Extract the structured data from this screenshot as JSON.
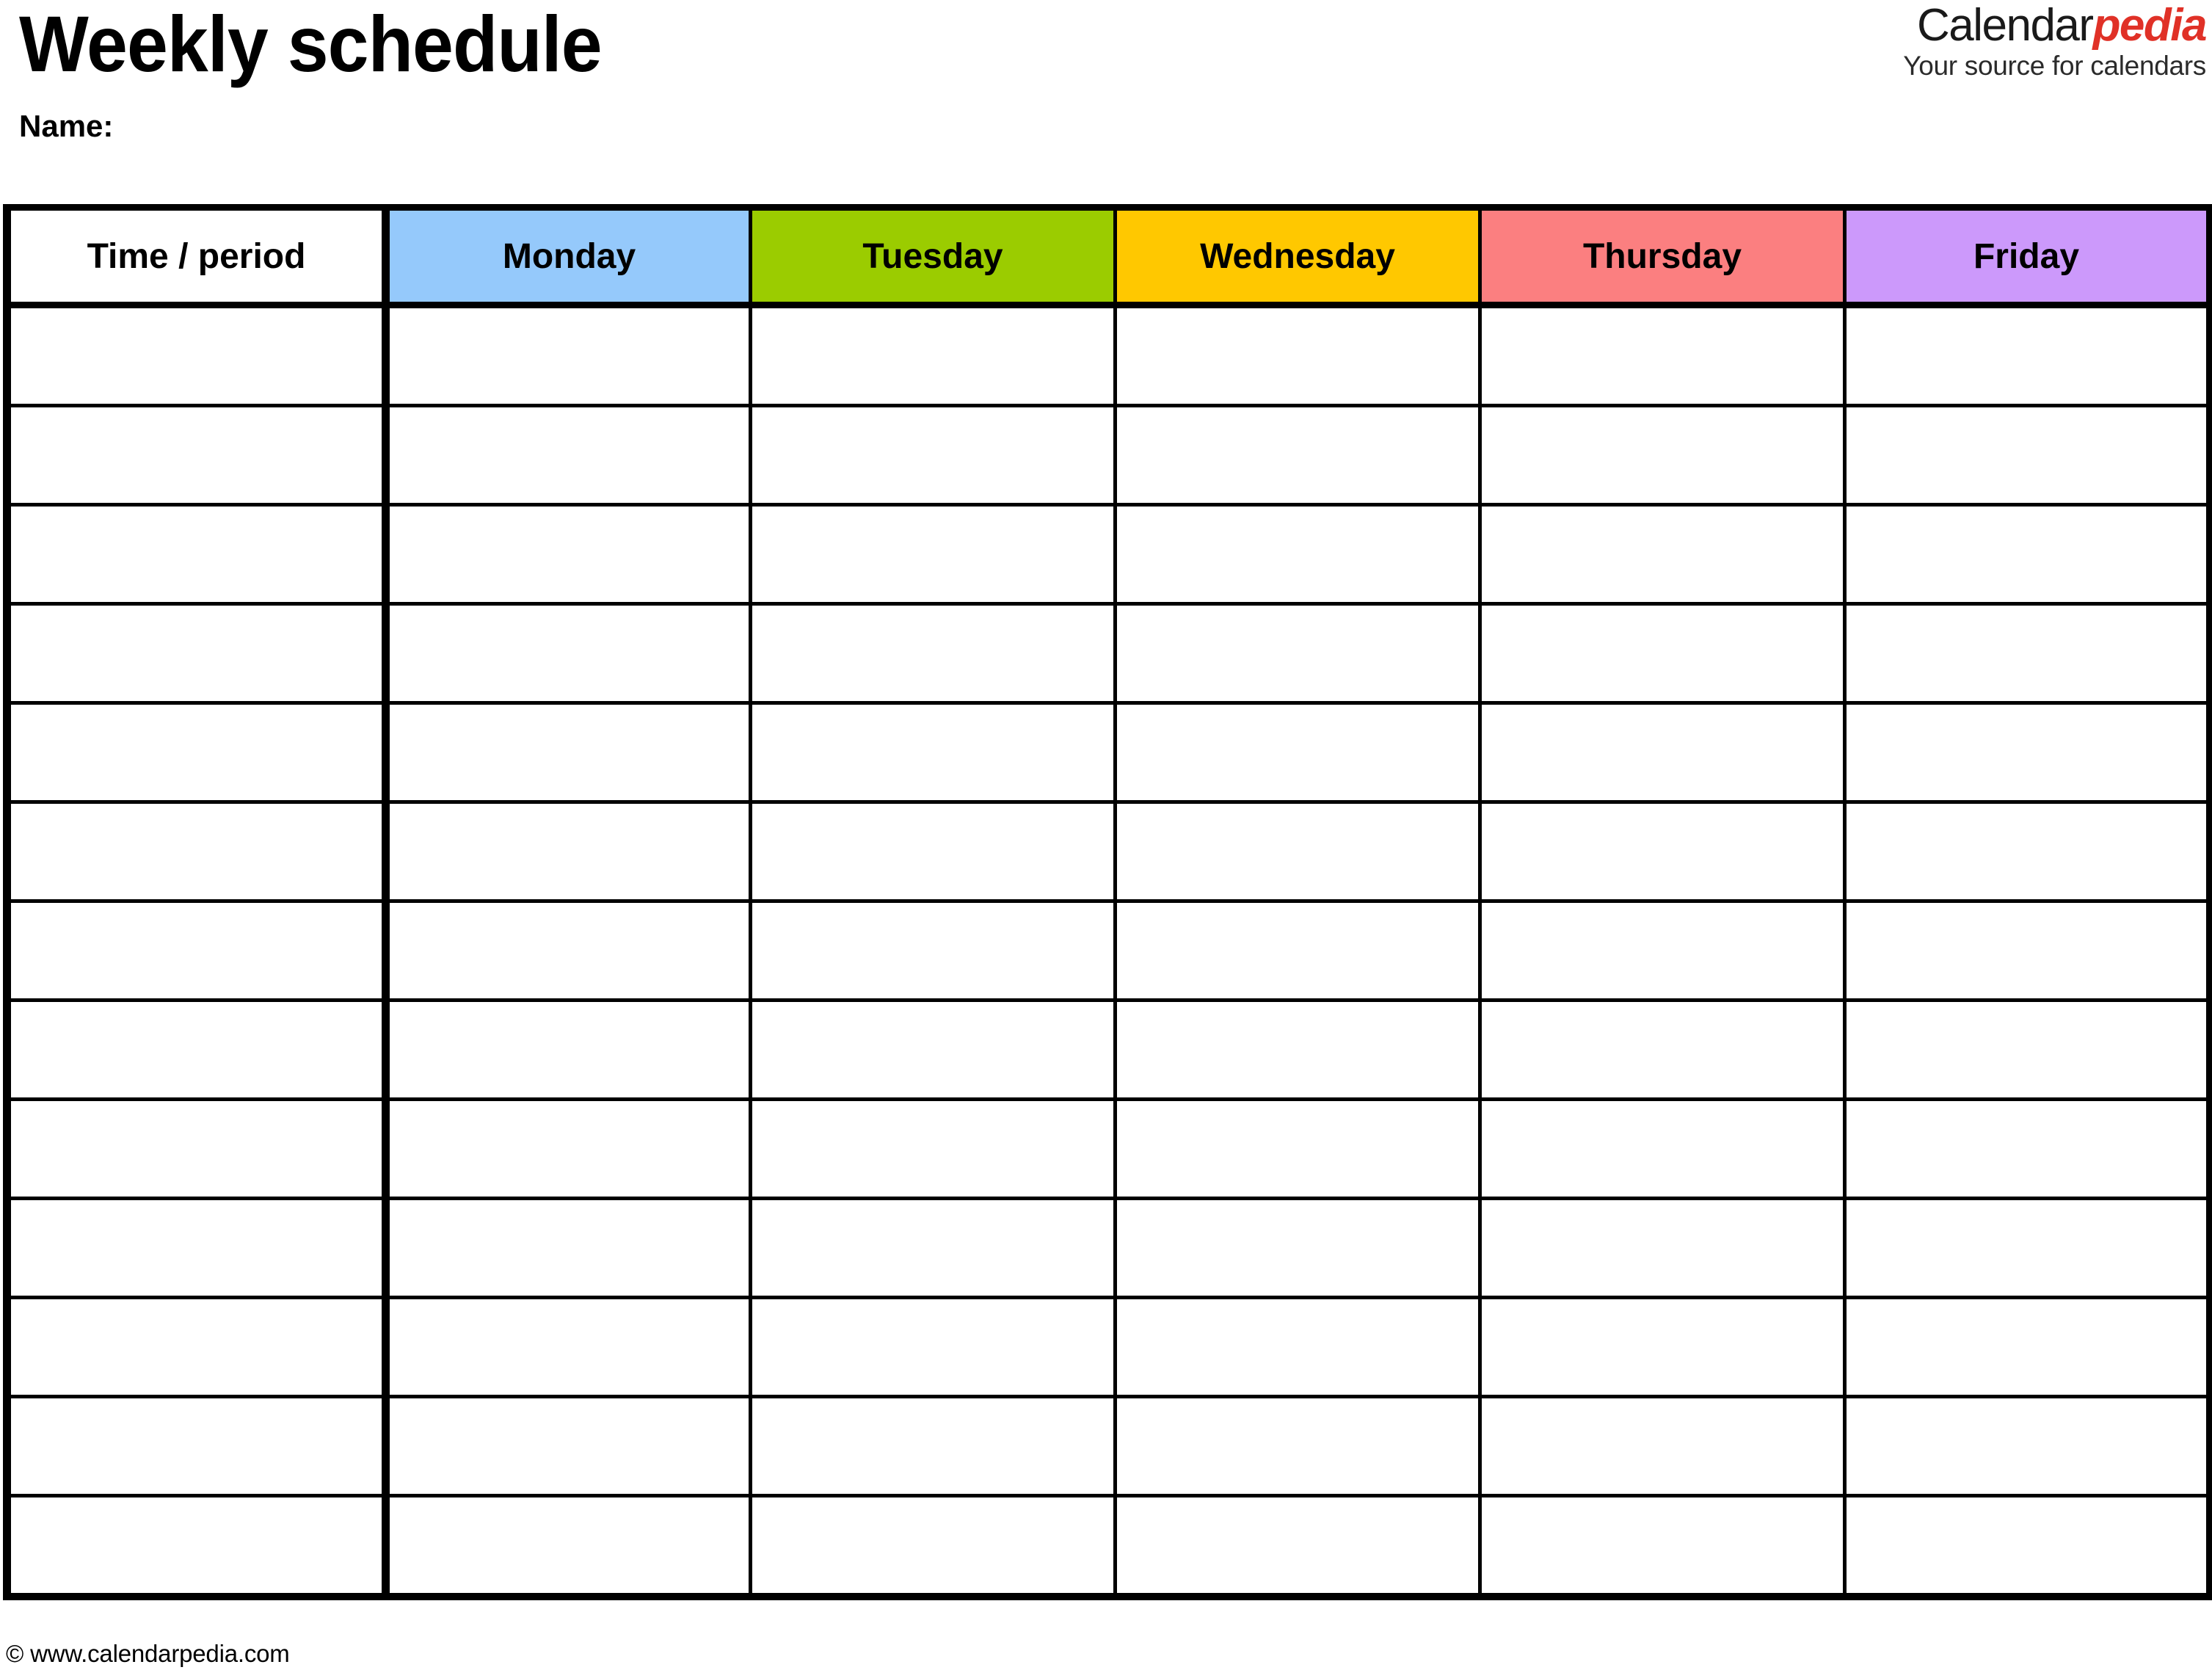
{
  "document": {
    "title": "Weekly schedule",
    "name_label": "Name:",
    "name_value": ""
  },
  "logo": {
    "brand_first": "Calendar",
    "brand_second": "pedia",
    "tagline": "Your source for calendars",
    "accent_color": "#e03127",
    "text_color": "#1a1a1a"
  },
  "table": {
    "columns": [
      {
        "key": "time",
        "label": "Time / period",
        "header_color": "#ffffff"
      },
      {
        "key": "monday",
        "label": "Monday",
        "header_color": "#95c9fb"
      },
      {
        "key": "tuesday",
        "label": "Tuesday",
        "header_color": "#9bcc00"
      },
      {
        "key": "wednesday",
        "label": "Wednesday",
        "header_color": "#ffc800"
      },
      {
        "key": "thursday",
        "label": "Thursday",
        "header_color": "#fb7f80"
      },
      {
        "key": "friday",
        "label": "Friday",
        "header_color": "#cc99fb"
      }
    ],
    "row_count": 13,
    "rows": [
      {
        "time": "",
        "monday": "",
        "tuesday": "",
        "wednesday": "",
        "thursday": "",
        "friday": ""
      },
      {
        "time": "",
        "monday": "",
        "tuesday": "",
        "wednesday": "",
        "thursday": "",
        "friday": ""
      },
      {
        "time": "",
        "monday": "",
        "tuesday": "",
        "wednesday": "",
        "thursday": "",
        "friday": ""
      },
      {
        "time": "",
        "monday": "",
        "tuesday": "",
        "wednesday": "",
        "thursday": "",
        "friday": ""
      },
      {
        "time": "",
        "monday": "",
        "tuesday": "",
        "wednesday": "",
        "thursday": "",
        "friday": ""
      },
      {
        "time": "",
        "monday": "",
        "tuesday": "",
        "wednesday": "",
        "thursday": "",
        "friday": ""
      },
      {
        "time": "",
        "monday": "",
        "tuesday": "",
        "wednesday": "",
        "thursday": "",
        "friday": ""
      },
      {
        "time": "",
        "monday": "",
        "tuesday": "",
        "wednesday": "",
        "thursday": "",
        "friday": ""
      },
      {
        "time": "",
        "monday": "",
        "tuesday": "",
        "wednesday": "",
        "thursday": "",
        "friday": ""
      },
      {
        "time": "",
        "monday": "",
        "tuesday": "",
        "wednesday": "",
        "thursday": "",
        "friday": ""
      },
      {
        "time": "",
        "monday": "",
        "tuesday": "",
        "wednesday": "",
        "thursday": "",
        "friday": ""
      },
      {
        "time": "",
        "monday": "",
        "tuesday": "",
        "wednesday": "",
        "thursday": "",
        "friday": ""
      },
      {
        "time": "",
        "monday": "",
        "tuesday": "",
        "wednesday": "",
        "thursday": "",
        "friday": ""
      }
    ]
  },
  "footer": {
    "copyright": "© www.calendarpedia.com"
  }
}
